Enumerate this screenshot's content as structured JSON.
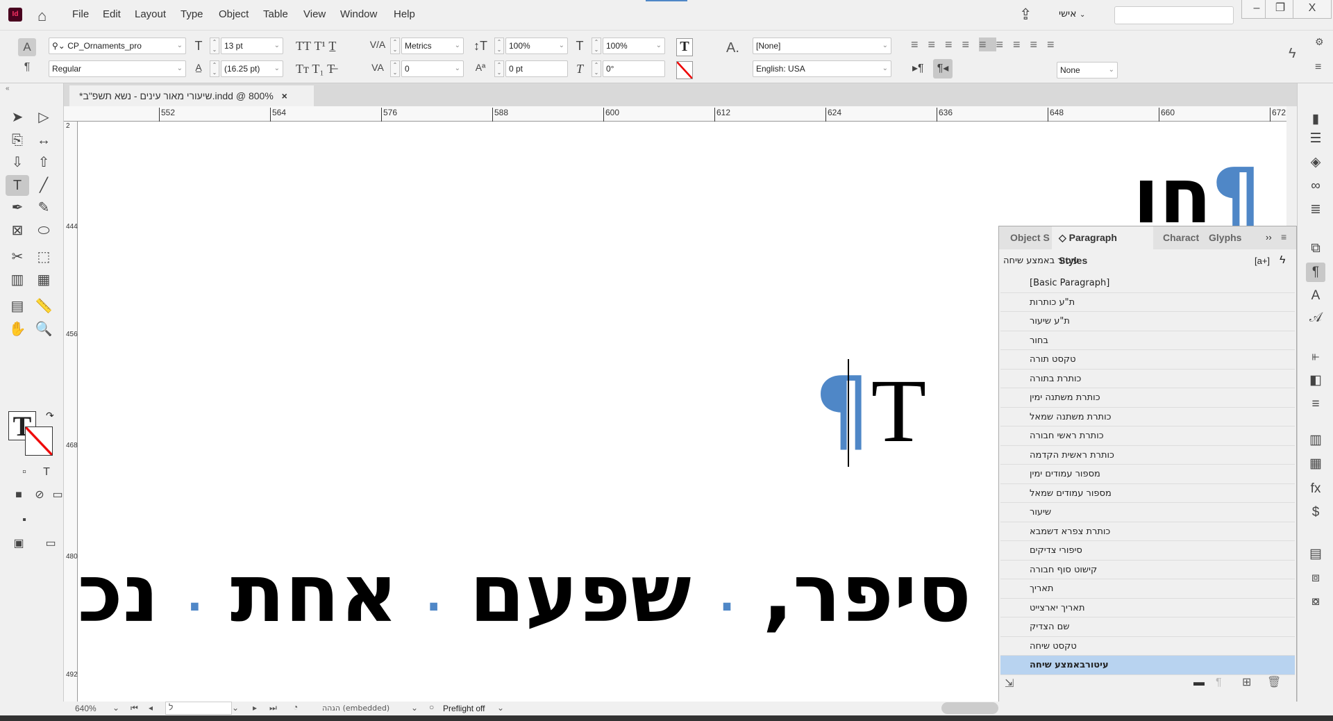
{
  "menubar": {
    "items": [
      "File",
      "Edit",
      "Layout",
      "Type",
      "Object",
      "Table",
      "View",
      "Window",
      "Help"
    ],
    "workspace": "אישי",
    "search_placeholder": "",
    "logo": "Id"
  },
  "control": {
    "font_family": "CP_Ornaments_pro",
    "font_style": "Regular",
    "font_size": "13 pt",
    "leading": "(16.25 pt)",
    "kerning": "Metrics",
    "tracking": "0",
    "vertical_scale": "100%",
    "horizontal_scale": "100%",
    "baseline_shift": "0 pt",
    "skew": "0°",
    "char_style": "[None]",
    "language": "English: USA",
    "kashida": "None"
  },
  "document": {
    "tab_title": "*שיעורי מאור עינים - נשא תשפ\"ב.indd @ 800%",
    "close": "×"
  },
  "ruler": {
    "h_labels": [
      "552",
      "564",
      "576",
      "588",
      "600",
      "612",
      "624",
      "636",
      "648",
      "660",
      "672"
    ],
    "v_labels": [
      "2",
      "444",
      "456",
      "468",
      "480",
      "492"
    ]
  },
  "canvas": {
    "words": [
      "׳",
      "סיפר,",
      "שפעם",
      "אחת",
      "נכנס"
    ],
    "separator": "·",
    "top_word": "חו",
    "pilcrow": "¶"
  },
  "panel": {
    "tabs": [
      "Object S",
      "Paragraph Styles",
      "Charact",
      "Glyphs"
    ],
    "current_style": "עיטור באמצע שיחה",
    "new_group_label": "[a+]",
    "styles": [
      "[Basic Paragraph]",
      "ת\"ע כותרות",
      "ת\"ע שיעור",
      "בחור",
      "טקסט תורה",
      "כותרת בתורה",
      "כותרת משתנה ימין",
      "כותרת משתנה שמאל",
      "כותרת ראשי חבורה",
      "כותרת ראשית הקדמה",
      "מספור עמודים ימין",
      "מספור עמודים שמאל",
      "שיעור",
      "כותרת צפרא דשמבא",
      "סיפורי צדיקים",
      "קישוט סוף חבורה",
      "תאריך",
      "תאריך יארצייט",
      "שם הצדיק",
      "טקסט שיחה",
      "עיטורבאמצע שיחה"
    ],
    "selected_index": 20
  },
  "status": {
    "zoom": "640%",
    "page": "ל",
    "profile": "הגהה (embedded)",
    "preflight": "Preflight off"
  },
  "colors": {
    "accent": "#4f87c7",
    "selection": "#b8d3f0"
  }
}
